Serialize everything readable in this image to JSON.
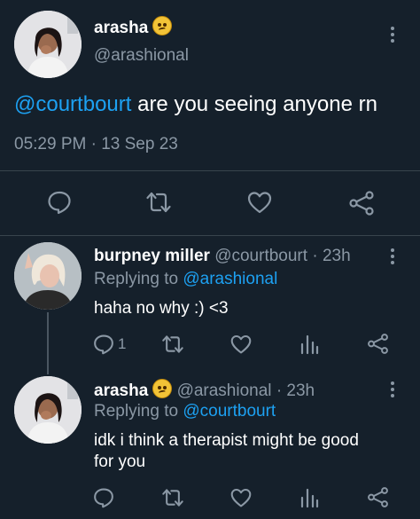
{
  "main_tweet": {
    "display_name": "arasha",
    "handle": "@arashional",
    "mention": "@courtbourt",
    "text": " are you seeing anyone rn",
    "time": "05:29 PM",
    "sep": "·",
    "date": "13 Sep 23"
  },
  "reply1": {
    "display_name": "burpney miller",
    "handle": "@courtbourt",
    "sep": "·",
    "age": "23h",
    "replying_to_prefix": "Replying to ",
    "replying_to": "@arashional",
    "text": "haha no why :) <3",
    "reply_count": "1"
  },
  "reply2": {
    "display_name": "arasha",
    "handle": "@arashional",
    "sep": "·",
    "age": "23h",
    "replying_to_prefix": "Replying to ",
    "replying_to": "@courtbourt",
    "text_line1": "idk i think a therapist might be good",
    "text_line2": "for you"
  },
  "icons": {
    "reply": "speech-bubble-icon",
    "retweet": "retweet-icon",
    "like": "heart-icon",
    "share": "share-icon",
    "analytics": "bar-chart-icon",
    "more": "more-vertical-icon",
    "emoji": "pleading-face-emoji"
  },
  "colors": {
    "background": "#15202b",
    "link": "#1da1f2",
    "muted": "#8b98a5",
    "divider": "#38444d"
  }
}
